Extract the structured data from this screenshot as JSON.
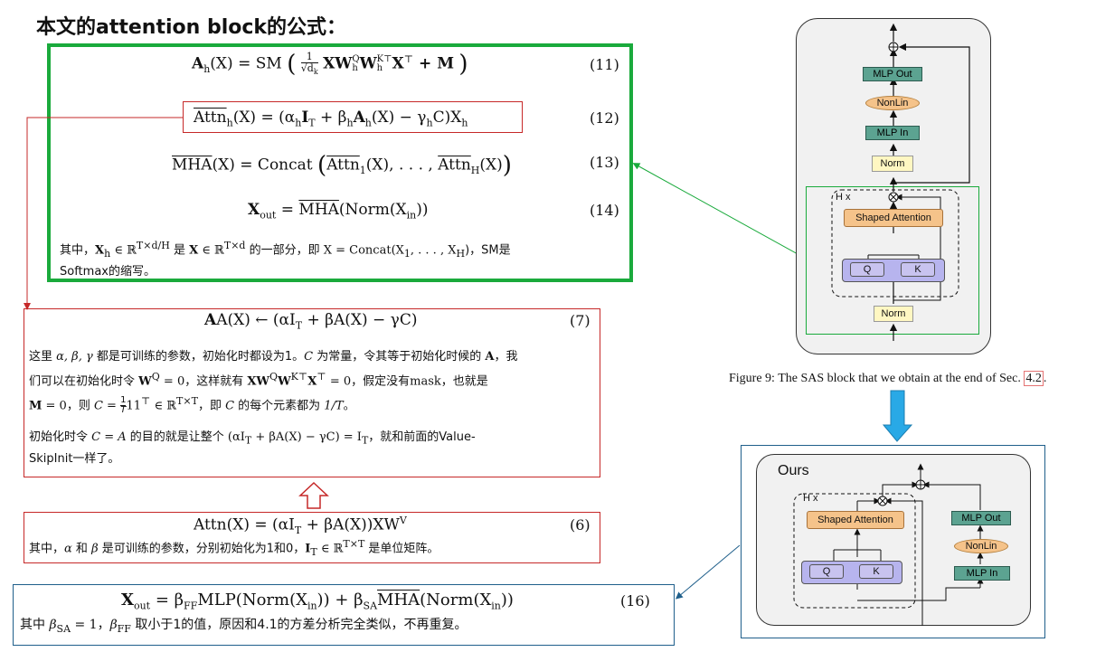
{
  "title": "本文的attention block的公式：",
  "green_box": {
    "eq11": {
      "lhs": "A",
      "lhs_sub": "h",
      "mid": "(X) = SM",
      "body": "XW",
      "sup1": "Q",
      "sub1": "h",
      "body2": "W",
      "sup2": "K⊤",
      "sub2": "h",
      "body3": "X",
      "sup3": "⊤",
      "tail": " + M",
      "frac_num": "1",
      "frac_den": "√d",
      "frac_den_sub": "k",
      "num": "(11)"
    },
    "eq12": {
      "text": "Attn",
      "sub": "h",
      "rest": "(X) = (α",
      "a_sub": "h",
      "rest2": "I",
      "t_sub": "T",
      "rest3": " + β",
      "b_sub": "h",
      "rest4": "A",
      "h_sub": "h",
      "rest5": "(X) − γ",
      "g_sub": "h",
      "rest6": "C)X",
      "x_sub": "h",
      "num": "(12)"
    },
    "eq13": {
      "lhs": "MHA",
      "mid": "(X) = Concat",
      "a1": "Attn",
      "a1_sub": "1",
      "dots": "(X), . . . ,",
      "a2": "Attn",
      "a2_sub": "H",
      "end": "(X)",
      "num": "(13)"
    },
    "eq14": {
      "lhs": "X",
      "lhs_sub": "out",
      "mid": " = ",
      "mha": "MHA",
      "end": "(Norm(X",
      "end_sub": "in",
      "end2": "))",
      "num": "(14)"
    },
    "para_pre": "其中，",
    "para_xh": "X",
    "para_xh_sub": "h",
    "para_in1": " ∈ ℝ",
    "para_in1_sup": "T×d/H",
    "para_mid1": " 是 ",
    "para_x": "X",
    "para_in2": " ∈ ℝ",
    "para_in2_sup": "T×d",
    "para_mid2": " 的一部分，即 ",
    "para_concat": "X = Concat(X",
    "para_c_sub1": "1",
    "para_concat2": ", . . . , X",
    "para_c_sub2": "H",
    "para_end": ")，SM是",
    "para_line2": "Softmax的缩写。"
  },
  "red_box_7": {
    "eq": "A(X) ← (αI",
    "eq_sub": "T",
    "eq2": " + βA(X) − γC)",
    "num": "(7)",
    "p1_a": "这里 ",
    "p1_greek": "α, β, γ",
    "p1_b": " 都是可训练的参数，初始化时都设为1。",
    "p1_c": "C",
    "p1_d": " 为常量，令其等于初始化时候的 ",
    "p1_e": "A",
    "p1_f": "，我",
    "p2_a": "们可以在初始化时令 ",
    "p2_w": "W",
    "p2_wsup": "Q",
    "p2_b": " = 0，这样就有 ",
    "p2_c": "XW",
    "p2_csup": "Q",
    "p2_d": "W",
    "p2_dsup": "K⊤",
    "p2_e": "X",
    "p2_esup": "⊤",
    "p2_f": " = 0，假定没有mask，也就是",
    "p3_a": "M",
    "p3_b": " = 0，则 ",
    "p3_c": "C = ",
    "p3_frac_num": "1",
    "p3_frac_den": "T",
    "p3_d": "11",
    "p3_dsup": "⊤",
    "p3_e": " ∈ ℝ",
    "p3_esup": "T×T",
    "p3_f": "，即 ",
    "p3_g": "C",
    "p3_h": " 的每个元素都为 ",
    "p3_i": "1/T",
    "p3_j": "。",
    "p4_a": "初始化时令 ",
    "p4_b": "C = A",
    "p4_c": " 的目的就是让整个 ",
    "p4_d": "(αI",
    "p4_dsub": "T",
    "p4_e": " + βA(X) − γC) = I",
    "p4_esub": "T",
    "p4_f": "，就和前面的Value-",
    "p5": "SkipInit一样了。"
  },
  "red_box_6": {
    "eq": "Attn(X) = (αI",
    "eq_sub": "T",
    "eq2": " + βA(X))XW",
    "eq_sup": "V",
    "num": "(6)",
    "p_a": "其中，",
    "p_b": "α",
    "p_c": " 和 ",
    "p_d": "β",
    "p_e": " 是可训练的参数，分别初始化为1和0，",
    "p_f": "I",
    "p_fsub": "T",
    "p_g": " ∈ ℝ",
    "p_gsup": "T×T",
    "p_h": " 是单位矩阵。"
  },
  "blue_box_16": {
    "eq": "X",
    "eq_sub": "out",
    "eq2": " = β",
    "b1_sub": "FF",
    "eq3": "MLP(Norm(X",
    "in1_sub": "in",
    "eq4": ")) + β",
    "b2_sub": "SA",
    "mha": "MHA",
    "eq5": "(Norm(X",
    "in2_sub": "in",
    "eq6": "))",
    "num": "(16)",
    "p_a": "其中 ",
    "p_b": "β",
    "p_bsub": "SA",
    "p_c": " = 1，",
    "p_d": "β",
    "p_dsub": "FF",
    "p_e": " 取小于1的值，原因和4.1的方差分析完全类似，不再重复。"
  },
  "figure9": {
    "mlp_out": "MLP Out",
    "nonlin": "NonLin",
    "mlp_in": "MLP In",
    "norm_top": "Norm",
    "hx": "H x",
    "shaped_attention": "Shaped Attention",
    "q": "Q",
    "k": "K",
    "norm_bottom": "Norm",
    "caption": "Figure 9: The SAS block that we obtain at the end of Sec.",
    "caption_ref": "4.2",
    "caption_end": "."
  },
  "ours": {
    "label": "Ours",
    "hx": "H x",
    "shaped_attention": "Shaped Attention",
    "q": "Q",
    "k": "K",
    "mlp_out": "MLP Out",
    "nonlin": "NonLin",
    "mlp_in": "MLP In"
  },
  "colors": {
    "green": "#1aaa3c",
    "red": "#c62828",
    "blue": "#1f5f8b",
    "arrow_blue": "#29a9e6"
  }
}
